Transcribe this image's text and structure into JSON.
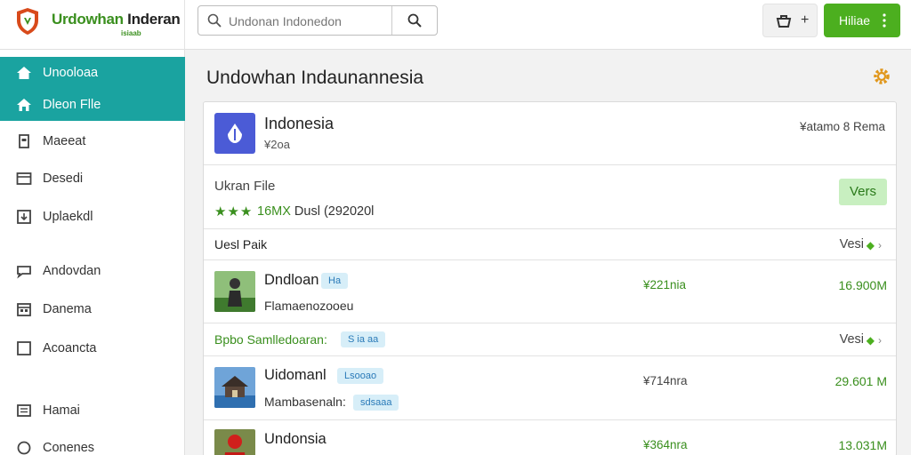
{
  "header": {
    "logo_title_pre": "Urdowhan ",
    "logo_title_post": "Inderan",
    "logo_subtitle": "isiaab",
    "search_placeholder": "Undonan Indonedon",
    "cart_plus": "+",
    "primary_button_label": "Hiliae"
  },
  "sidebar": {
    "items": [
      {
        "label": "Unooloaa",
        "icon": "home-icon",
        "active": true
      },
      {
        "label": "Dleon Flle",
        "icon": "home-outline-icon",
        "active": true
      },
      {
        "label": "Maeeat",
        "icon": "document-icon",
        "active": false
      },
      {
        "label": "Desedi",
        "icon": "window-icon",
        "active": false
      },
      {
        "label": "Uplaekdl",
        "icon": "upload-icon",
        "active": false
      },
      {
        "label": "Andovdan",
        "icon": "chat-icon",
        "active": false
      },
      {
        "label": "Danema",
        "icon": "calendar-icon",
        "active": false
      },
      {
        "label": "Acoancta",
        "icon": "checkbox-icon",
        "active": false
      },
      {
        "label": "Hamai",
        "icon": "list-icon",
        "active": false
      },
      {
        "label": "Conenes",
        "icon": "circle-icon",
        "active": false
      }
    ]
  },
  "main": {
    "title": "Undowhan Indaunannesia",
    "app": {
      "name": "Indonesia",
      "price": "¥2oa",
      "right_text": "¥atamo 8 Rema"
    },
    "file": {
      "title": "Ukran File",
      "stars": "★★★",
      "rating_count": "16MX",
      "rating_text": " Dusl (292020l",
      "button_label": "Vers"
    },
    "sections": [
      {
        "heading": "Uesl Paik",
        "right_label": "Vesi",
        "badge": "",
        "rows": [
          {
            "name": "Dndloan",
            "tag": "Ha",
            "sub": "Flamaenozooeu",
            "sub_tag": "",
            "price": "¥221nia",
            "price_color": "#3a8f1e",
            "size": "16.900M"
          }
        ]
      },
      {
        "heading": "Bpbo Samlledoaran:",
        "right_label": "Vesi",
        "badge": "S ia aa",
        "rows": [
          {
            "name": "Uidomanl",
            "tag": "Lsooao",
            "sub": "Mambasenaln:",
            "sub_tag": "sdsaaa",
            "price": "¥714nra",
            "price_color": "#444444",
            "size": "29.601 M"
          },
          {
            "name": "Undonsia",
            "tag": "",
            "sub": "",
            "sub_tag": "",
            "price": "¥364nra",
            "price_color": "#3a8f1e",
            "size": "13.031M"
          }
        ]
      }
    ]
  },
  "colors": {
    "accent_teal": "#1aa3a0",
    "brand_green": "#4caf1f",
    "app_icon_blue": "#4b5bd6"
  }
}
